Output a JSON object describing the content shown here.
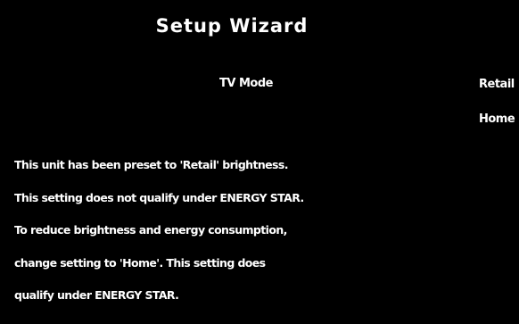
{
  "wizard": {
    "title": "Setup Wizard"
  },
  "tv_mode": {
    "label": "TV Mode",
    "options": [
      {
        "label": "Retail",
        "selected": true
      },
      {
        "label": "Home",
        "selected": false
      }
    ]
  },
  "notice": {
    "lines": [
      "This unit has been preset to 'Retail' brightness.",
      "This setting does not qualify under ENERGY STAR.",
      "To reduce brightness and energy consumption,",
      "change setting to 'Home'. This setting does",
      "qualify under ENERGY STAR."
    ]
  },
  "colors": {
    "background": "#000000",
    "text": "#ffffff"
  }
}
